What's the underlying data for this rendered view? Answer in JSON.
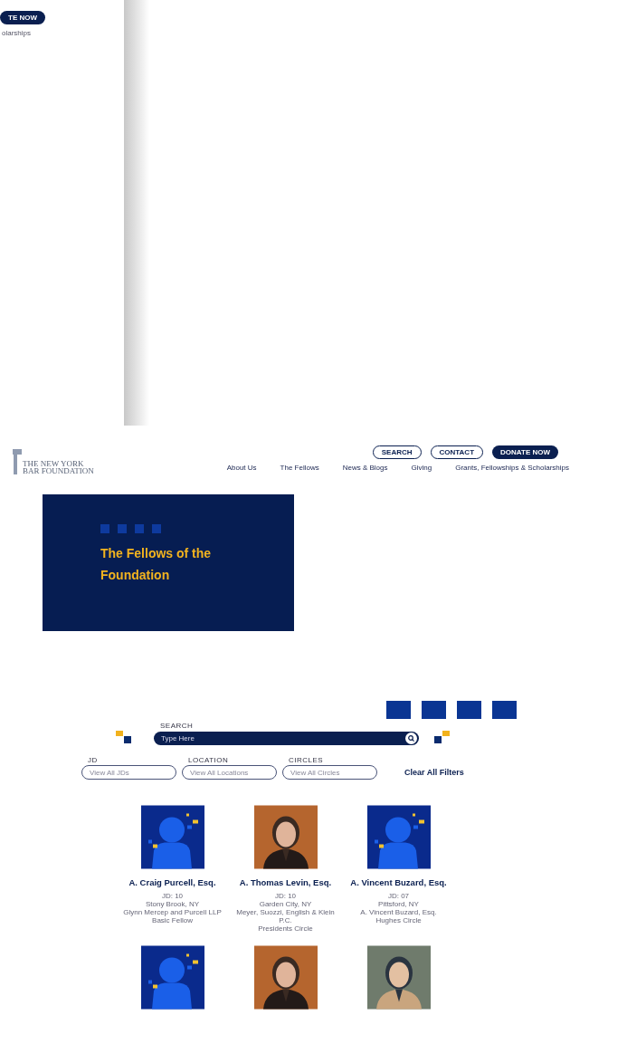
{
  "overlay_panel": {
    "button": "TE NOW",
    "link": "olarships"
  },
  "header": {
    "logo": [
      "THE NEW YORK",
      "BAR FOUNDATION"
    ],
    "buttons": [
      {
        "label": "SEARCH",
        "kind": "outline"
      },
      {
        "label": "CONTACT",
        "kind": "outline"
      },
      {
        "label": "DONATE NOW",
        "kind": "filled"
      }
    ],
    "nav": [
      "About Us",
      "The Fellows",
      "News & Blogs",
      "Giving",
      "Grants, Fellowships & Scholarships"
    ]
  },
  "hero": {
    "title": "The Fellows of the Foundation"
  },
  "search": {
    "label": "SEARCH",
    "placeholder": "Type Here"
  },
  "filters": [
    {
      "label": "JD",
      "placeholder": "View All JDs"
    },
    {
      "label": "LOCATION",
      "placeholder": "View All Locations"
    },
    {
      "label": "CIRCLES",
      "placeholder": "View All Circles"
    }
  ],
  "clear_filters": "Clear All Filters",
  "fellows": [
    {
      "kind": "placeholder",
      "name": "A. Craig Purcell, Esq.",
      "details": [
        "JD: 10",
        "Stony Brook, NY",
        "Glynn Mercep and Purcell LLP",
        "Basic Fellow"
      ]
    },
    {
      "kind": "picture",
      "name": "A. Thomas Levin, Esq.",
      "details": [
        "JD: 10",
        "Garden City, NY",
        "Meyer, Suozzi, English & Klein P.C.",
        "Presidents Circle"
      ]
    },
    {
      "kind": "placeholder",
      "name": "A. Vincent Buzard, Esq.",
      "details": [
        "JD: 07",
        "Pittsford, NY",
        "A. Vincent Buzard, Esq.",
        "Hughes Circle"
      ]
    },
    {
      "kind": "placeholder"
    },
    {
      "kind": "picture"
    },
    {
      "kind": "picture"
    }
  ]
}
